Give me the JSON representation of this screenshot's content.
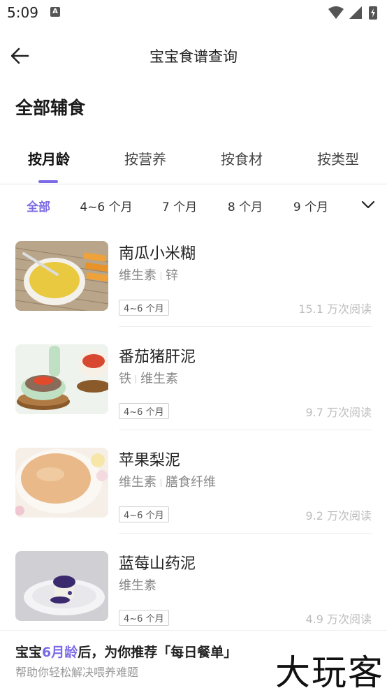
{
  "status_bar": {
    "time": "5:09",
    "notification_icon": "A"
  },
  "header": {
    "title": "宝宝食谱查询",
    "back_icon": "arrow-left-icon"
  },
  "section": {
    "title": "全部辅食"
  },
  "tabs": [
    {
      "label": "按月龄",
      "active": true
    },
    {
      "label": "按营养",
      "active": false
    },
    {
      "label": "按食材",
      "active": false
    },
    {
      "label": "按类型",
      "active": false
    }
  ],
  "age_filters": [
    {
      "label": "全部",
      "active": true
    },
    {
      "label": "4~6 个月",
      "active": false
    },
    {
      "label": "7 个月",
      "active": false
    },
    {
      "label": "8 个月",
      "active": false
    },
    {
      "label": "9 个月",
      "active": false
    }
  ],
  "recipes": [
    {
      "name": "南瓜小米糊",
      "tags": [
        "维生素",
        "锌"
      ],
      "age": "4~6 个月",
      "views": "15.1 万次阅读"
    },
    {
      "name": "番茄猪肝泥",
      "tags": [
        "铁",
        "维生素"
      ],
      "age": "4~6 个月",
      "views": "9.7 万次阅读"
    },
    {
      "name": "苹果梨泥",
      "tags": [
        "维生素",
        "膳食纤维"
      ],
      "age": "4~6 个月",
      "views": "9.2 万次阅读"
    },
    {
      "name": "蓝莓山药泥",
      "tags": [
        "维生素"
      ],
      "age": "4~6 个月",
      "views": "4.9 万次阅读"
    }
  ],
  "banner": {
    "prefix": "宝宝",
    "highlight": "6月龄",
    "suffix": "后，为你推荐「每日餐单」",
    "subtitle": "帮助你轻松解决喂养难题",
    "watermark": "大玩客"
  },
  "colors": {
    "accent": "#7b6be5"
  }
}
